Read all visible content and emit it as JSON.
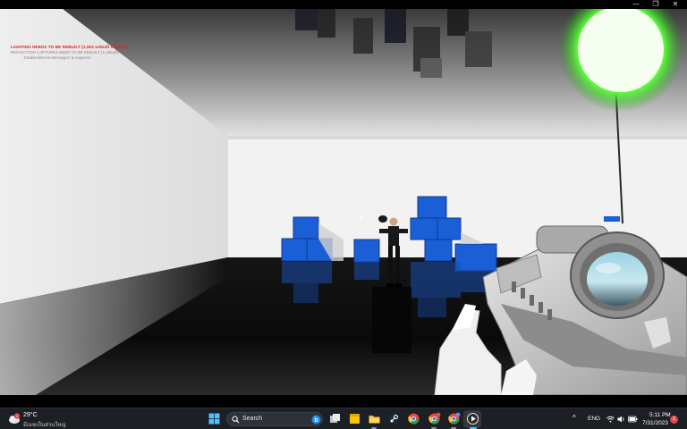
{
  "window": {
    "controls": {
      "minimize": "—",
      "maximize": "❐",
      "close": "✕"
    }
  },
  "game": {
    "warning_line1": "LIGHTING NEEDS TO BE REBUILT (1,502 unbuilt objects)",
    "warning_line2": "REFLECTION CAPTURES NEED TO BE REBUILT (1 unbuilt)",
    "warning_line3": "'DisableAllScreenMessages' to suppress",
    "colors": {
      "cube_blue": "#1a5fd6",
      "light_green": "#7dff6a",
      "wall": "#f2f2f2",
      "floor": "#0c0c0c"
    }
  },
  "taskbar": {
    "weather": {
      "temp": "29°C",
      "desc": "มีเมฆเป็นส่วนใหญ่",
      "icon": "cloud-sun-icon",
      "badge": "1"
    },
    "search_placeholder": "Search",
    "apps": [
      "windows-start-icon",
      "search-icon",
      "bing-chat-icon",
      "task-view-icon",
      "sticky-notes-icon",
      "file-explorer-icon",
      "steam-icon",
      "chrome-icon",
      "chrome-profile-icon",
      "chrome-profile2-icon",
      "media-player-icon"
    ],
    "tray": {
      "chevron": "^",
      "language": "ENG",
      "time": "5:11 PM",
      "date": "7/31/2023",
      "notification_count": "1"
    }
  }
}
